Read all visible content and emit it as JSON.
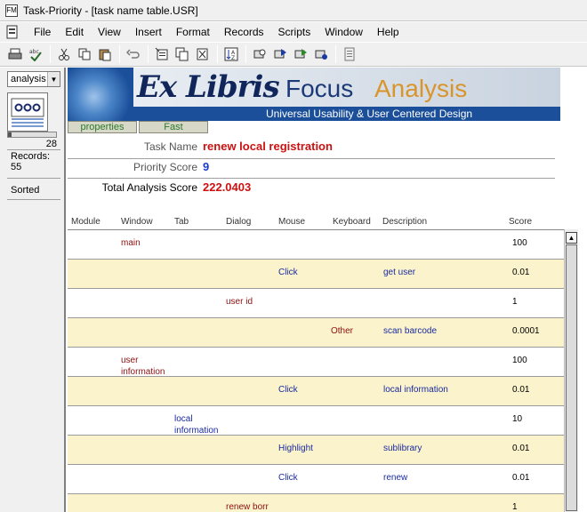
{
  "window": {
    "title": "Task-Priority - [task name table.USR]"
  },
  "menu": [
    "File",
    "Edit",
    "View",
    "Insert",
    "Format",
    "Records",
    "Scripts",
    "Window",
    "Help"
  ],
  "status": {
    "layout": "analysis",
    "record_number": "28",
    "records_label": "Records:",
    "records_count": "55",
    "sort_state": "Sorted"
  },
  "banner": {
    "brand_ex": "Ex Libris",
    "brand_focus": "Focus",
    "brand_analysis": "Analysis",
    "subtitle": "Universal Usability & User Centered Design"
  },
  "tabs": [
    "properties",
    "Fast"
  ],
  "fields": {
    "task_name_label": "Task Name",
    "task_name": "renew local registration",
    "priority_score_label": "Priority Score",
    "priority_score": "9",
    "total_score_label": "Total Analysis Score",
    "total_score": "222.0403"
  },
  "columns": [
    "Module",
    "Window",
    "Tab",
    "Dialog",
    "Mouse",
    "Keyboard",
    "Description",
    "Score"
  ],
  "rows": [
    {
      "module": "",
      "window": "main",
      "tab": "",
      "dialog": "",
      "mouse": "",
      "keyboard": "",
      "description": "",
      "score": "100"
    },
    {
      "module": "",
      "window": "",
      "tab": "",
      "dialog": "",
      "mouse": "Click",
      "keyboard": "",
      "description": "get user",
      "score": "0.01"
    },
    {
      "module": "",
      "window": "",
      "tab": "",
      "dialog": "user id",
      "mouse": "",
      "keyboard": "",
      "description": "",
      "score": "1"
    },
    {
      "module": "",
      "window": "",
      "tab": "",
      "dialog": "",
      "mouse": "",
      "keyboard": "Other",
      "description": "scan barcode",
      "score": "0.0001"
    },
    {
      "module": "",
      "window": "user\ninformation",
      "tab": "",
      "dialog": "",
      "mouse": "",
      "keyboard": "",
      "description": "",
      "score": "100"
    },
    {
      "module": "",
      "window": "",
      "tab": "",
      "dialog": "",
      "mouse": "Click",
      "keyboard": "",
      "description": "local information",
      "score": "0.01"
    },
    {
      "module": "",
      "window": "",
      "tab": "local\ninformation",
      "dialog": "",
      "mouse": "",
      "keyboard": "",
      "description": "",
      "score": "10"
    },
    {
      "module": "",
      "window": "",
      "tab": "",
      "dialog": "",
      "mouse": "Highlight",
      "keyboard": "",
      "description": "sublibrary",
      "score": "0.01"
    },
    {
      "module": "",
      "window": "",
      "tab": "",
      "dialog": "",
      "mouse": "Click",
      "keyboard": "",
      "description": "renew",
      "score": "0.01"
    },
    {
      "module": "",
      "window": "",
      "tab": "",
      "dialog": "renew borr",
      "mouse": "",
      "keyboard": "",
      "description": "",
      "score": "1"
    }
  ],
  "colors": {
    "label_red": "#8a1010",
    "value_red": "#cc1111",
    "value_blue": "#1a2aa0",
    "row_alt": "#faf3cc",
    "banner_blue": "#1b4f9a"
  }
}
